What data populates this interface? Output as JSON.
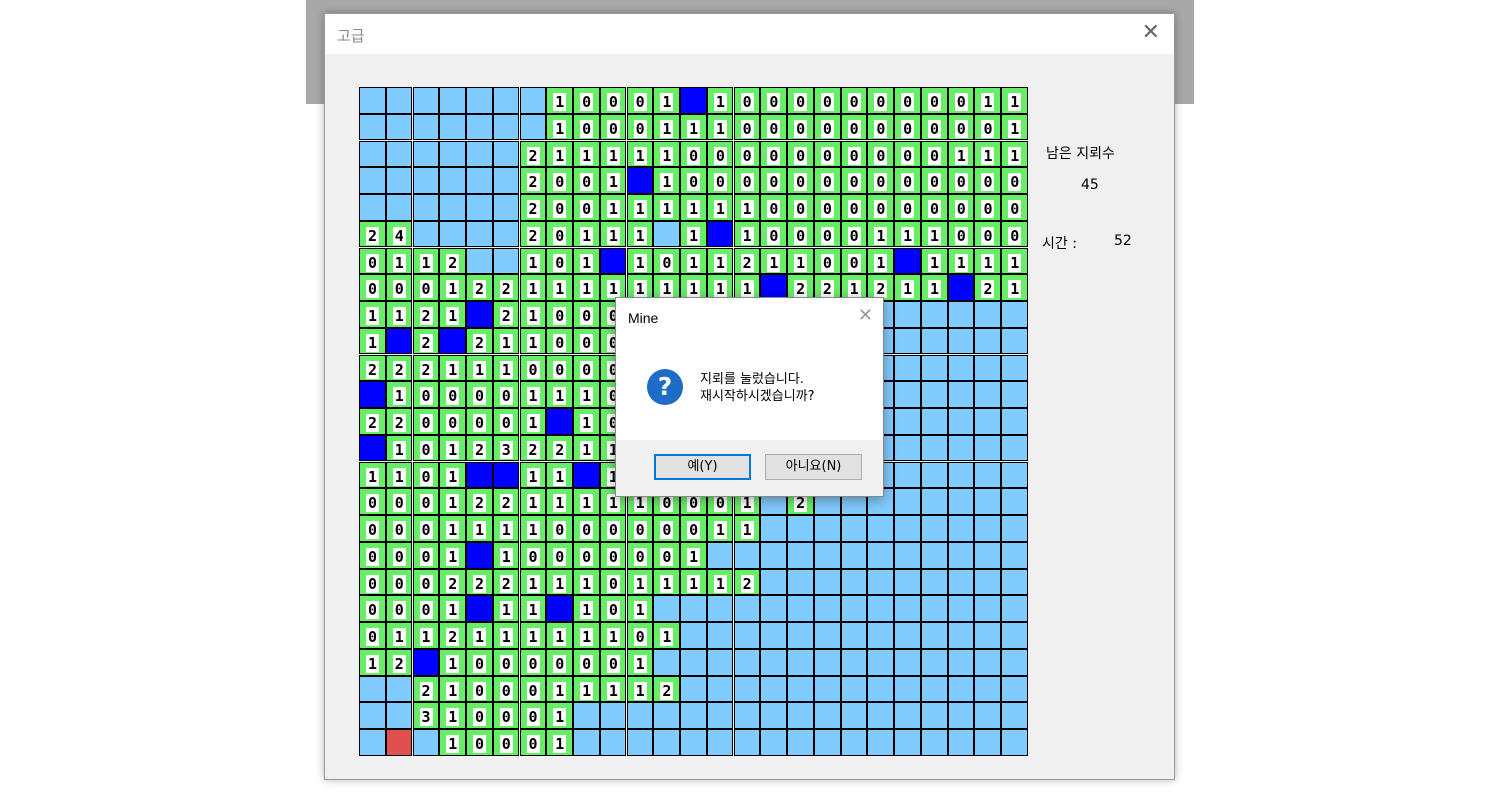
{
  "window": {
    "title": "고급",
    "close_glyph": "✕"
  },
  "status": {
    "remaining_label": "남은 지뢰수",
    "remaining_value": "45",
    "time_label": "시간 :",
    "time_value": "52"
  },
  "dialog": {
    "title": "Mine",
    "close_glyph": "✕",
    "icon": "question-icon",
    "icon_glyph": "?",
    "message_line1": "지뢰를 눌렀습니다.",
    "message_line2": "재시작하시겠습니까?",
    "yes_label": "예(Y)",
    "no_label": "아니요(N)"
  },
  "colors": {
    "unopened": "#80cbff",
    "opened": "#66ee66",
    "mine": "#0000ff",
    "clicked_mine": "#e05050",
    "accent": "#0078d7"
  },
  "board": {
    "cols": 25,
    "rows": 25,
    "legend": {
      ".": "unopened",
      "M": "mine",
      "X": "clicked-mine",
      "0-9": "opened cell with number"
    },
    "grid": [
      ".......10001M1000000000111",
      ".......100011100000000001M1",
      "......2111110000000000111",
      "......2001M10000000000000",
      "......2001111110000000000",
      "24....20111O1M1000011100000",
      "0112..101M1011211001M11110",
      "000122111111111M221211M21",
      "1121M21000.................",
      "1M2M211000",
      "222111000000",
      "M100001110",
      "2200001M100",
      "M10123221111",
      "1101MM11M1",
      "000122111110001.2",
      "000111100000011",
      "0001M10000001",
      "000222111011112",
      "0001M11M101",
      "011211111101",
      "12M10000001",
      "..2100011112",
      "..310001",
      ".X.10001"
    ]
  }
}
